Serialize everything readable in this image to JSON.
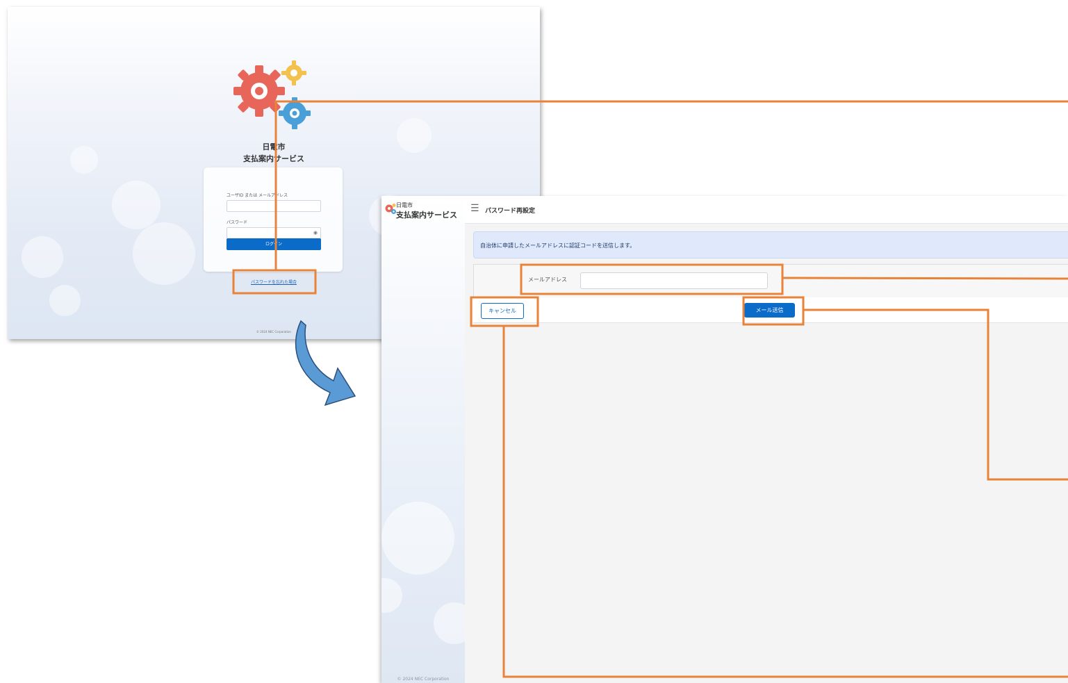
{
  "login": {
    "city": "日電市",
    "service": "支払案内サービス",
    "userid_label": "ユーザID または メールアドレス",
    "password_label": "パスワード",
    "login_button": "ログイン",
    "forgot_link": "パスワードを忘れた場合",
    "copyright": "© 2024 NEC Corporation",
    "eye_icon": "eye-icon"
  },
  "reset": {
    "brand_city": "日電市",
    "brand_service": "支払案内サービス",
    "page_title": "パスワード再設定",
    "menu_icon": "hamburger-icon",
    "info_message": "自治体に申請したメールアドレスに認証コードを送信します。",
    "email_label": "メールアドレス",
    "email_value": "",
    "cancel_button": "キャンセル",
    "send_button": "メール送信",
    "copyright": "© 2024 NEC Corporation"
  },
  "colors": {
    "primary": "#0a6bc9",
    "annotation": "#e8833a",
    "arrow": "#5b9bd5",
    "gear_red": "#e8655a",
    "gear_yellow": "#f2c14e",
    "gear_blue": "#4a9fd8"
  }
}
